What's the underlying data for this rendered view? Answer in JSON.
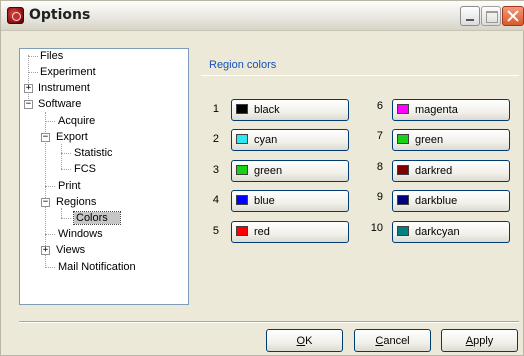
{
  "window": {
    "title": "Options"
  },
  "tree": {
    "items": [
      {
        "label": "Files"
      },
      {
        "label": "Experiment"
      },
      {
        "label": "Instrument",
        "expander": "+"
      },
      {
        "label": "Software",
        "expander": "−"
      },
      {
        "label": "Acquire"
      },
      {
        "label": "Export",
        "expander": "−"
      },
      {
        "label": "Statistic"
      },
      {
        "label": "FCS"
      },
      {
        "label": "Print"
      },
      {
        "label": "Regions",
        "expander": "−"
      },
      {
        "label": "Colors",
        "selected": true
      },
      {
        "label": "Windows"
      },
      {
        "label": "Views",
        "expander": "+"
      },
      {
        "label": "Mail Notification"
      }
    ]
  },
  "region_colors": {
    "title": "Region colors",
    "entries": [
      {
        "number": "1",
        "label": "black",
        "color": "#000000"
      },
      {
        "number": "2",
        "label": "cyan",
        "color": "#2ee6f0"
      },
      {
        "number": "3",
        "label": "green",
        "color": "#18d218"
      },
      {
        "number": "4",
        "label": "blue",
        "color": "#0000ff"
      },
      {
        "number": "5",
        "label": "red",
        "color": "#ff0000"
      },
      {
        "number": "6",
        "label": "magenta",
        "color": "#ff00ff"
      },
      {
        "number": "7",
        "label": "green",
        "color": "#18d218"
      },
      {
        "number": "8",
        "label": "darkred",
        "color": "#800000"
      },
      {
        "number": "9",
        "label": "darkblue",
        "color": "#000080"
      },
      {
        "number": "10",
        "label": "darkcyan",
        "color": "#008080"
      }
    ]
  },
  "buttons": {
    "ok_underlined": "O",
    "ok_rest": "K",
    "cancel_underlined": "C",
    "cancel_rest": "ancel",
    "apply_underlined": "A",
    "apply_rest": "pply"
  }
}
